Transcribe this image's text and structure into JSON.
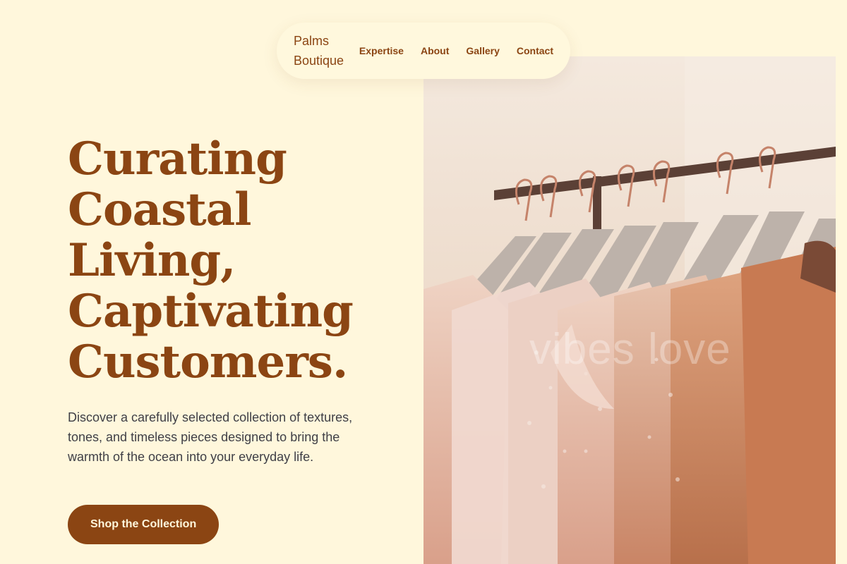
{
  "brand": {
    "line1": "Palms",
    "line2": "Boutique"
  },
  "nav": {
    "links": [
      "Expertise",
      "About",
      "Gallery",
      "Contact"
    ]
  },
  "hero": {
    "headline_lines": [
      "Curating",
      "Coastal",
      "Living,",
      "Captivating",
      "Customers."
    ],
    "subtext": "Discover a carefully selected collection of textures, tones, and timeless pieces designed to bring the warmth of the ocean into your everyday life.",
    "cta_label": "Shop the Collection",
    "image_watermark": "vibes love"
  },
  "colors": {
    "background": "#fff7dc",
    "brand": "#8b4513",
    "body_text": "#3f3f46"
  }
}
